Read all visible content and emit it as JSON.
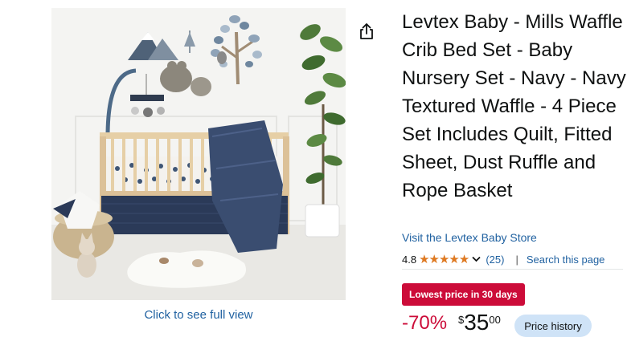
{
  "product": {
    "title": "Levtex Baby - Mills Waffle Crib Bed Set - Baby Nursery Set - Navy - Navy Textured Waffle - 4 Piece Set Includes Quilt, Fitted Sheet, Dust Ruffle and Rope Basket",
    "store_link": "Visit the Levtex Baby Store",
    "image_caption": "Click to see full view",
    "share_icon": "share-icon"
  },
  "rating": {
    "value": "4.8",
    "stars": "★★★★★",
    "stars_fraction": 0.96,
    "count": "(25)",
    "separator": "|",
    "search_link": "Search this page"
  },
  "pricing": {
    "badge": "Lowest price in 30 days",
    "discount": "-70%",
    "currency_symbol": "$",
    "whole": "35",
    "fraction": "00",
    "history_button": "Price history"
  },
  "colors": {
    "link": "#2162a1",
    "deal_red": "#cc0c39",
    "star_orange": "#de7921",
    "history_bg": "#cfe3f7"
  }
}
